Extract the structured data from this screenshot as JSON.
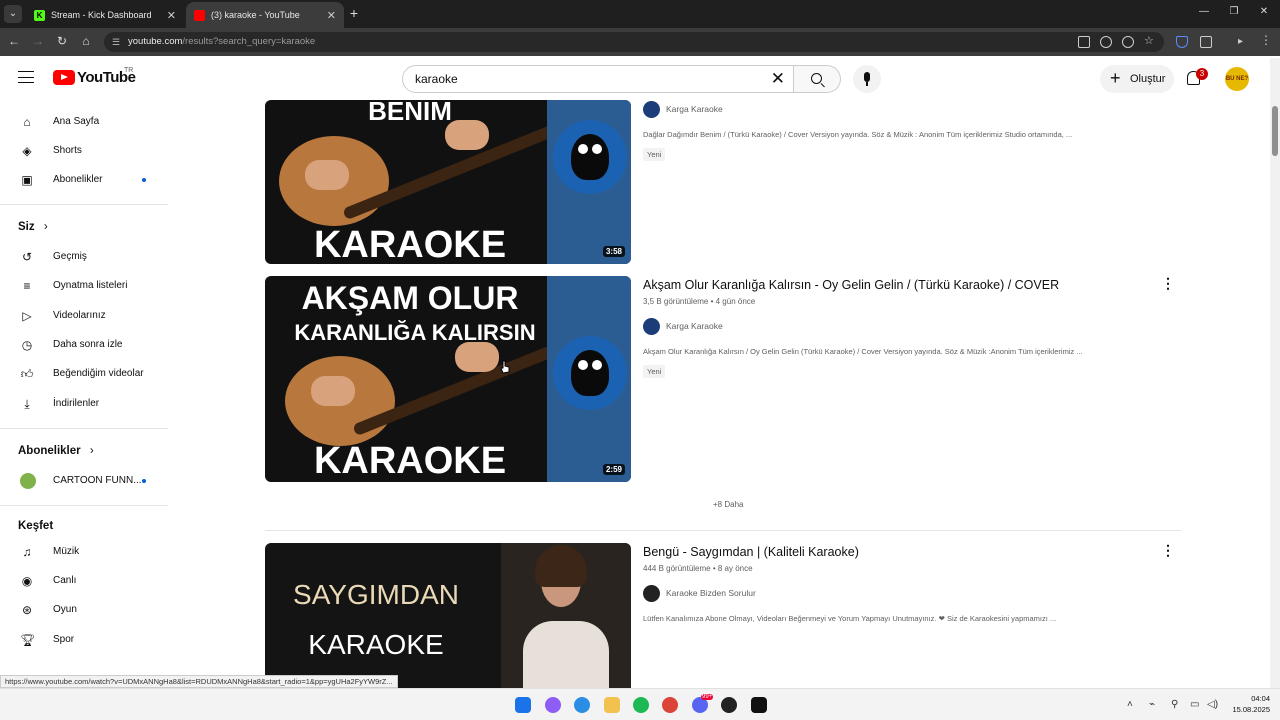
{
  "browser": {
    "tabs": [
      {
        "title": "Stream - Kick Dashboard",
        "favicon": "kick-icon"
      },
      {
        "title": "(3) karaoke - YouTube",
        "favicon": "youtube-icon"
      }
    ],
    "url_host": "youtube.com",
    "url_path": "/results?search_query=karaoke"
  },
  "masthead": {
    "logo": "YouTube",
    "region": "TR",
    "search_value": "karaoke",
    "create_label": "Oluştur",
    "notification_count": "3",
    "avatar_text": "BU NE?"
  },
  "sidebar": {
    "main": [
      {
        "label": "Ana Sayfa",
        "icon": "home-icon"
      },
      {
        "label": "Shorts",
        "icon": "shorts-icon"
      },
      {
        "label": "Abonelikler",
        "icon": "subscriptions-icon"
      }
    ],
    "you_heading": "Siz",
    "you": [
      {
        "label": "Geçmiş",
        "icon": "history-icon"
      },
      {
        "label": "Oynatma listeleri",
        "icon": "playlists-icon"
      },
      {
        "label": "Videolarınız",
        "icon": "your-videos-icon"
      },
      {
        "label": "Daha sonra izle",
        "icon": "watch-later-icon"
      },
      {
        "label": "Beğendiğim videolar",
        "icon": "liked-icon"
      },
      {
        "label": "İndirilenler",
        "icon": "downloads-icon"
      }
    ],
    "subs_heading": "Abonelikler",
    "subs": [
      {
        "label": "CARTOON FUNN..."
      }
    ],
    "explore_heading": "Keşfet",
    "explore": [
      {
        "label": "Müzik",
        "icon": "music-icon"
      },
      {
        "label": "Canlı",
        "icon": "live-icon"
      },
      {
        "label": "Oyun",
        "icon": "gaming-icon"
      },
      {
        "label": "Spor",
        "icon": "sports-icon"
      }
    ]
  },
  "results": [
    {
      "thumb_top": "BENIM",
      "thumb_bottom": "KARAOKE",
      "duration": "3:58",
      "channel": "Karga Karaoke",
      "description": "Dağlar Dağımdır Benim / (Türkü Karaoke) / Cover Versiyon yayında. Söz & Müzik : Anonim Tüm içeriklerimiz Studio ortamında, ...",
      "badge": "Yeni"
    },
    {
      "thumb_top": "AKŞAM OLUR",
      "thumb_mid": "KARANLIĞA KALIRSIN",
      "thumb_bottom": "KARAOKE",
      "duration": "2:59",
      "title": "Akşam Olur Karanlığa Kalırsın - Oy Gelin Gelin / (Türkü Karaoke) / COVER",
      "views": "3,5 B görüntüleme",
      "age": "4 gün önce",
      "channel": "Karga Karaoke",
      "description": "Akşam Olur Karanlığa Kalırsın / Oy Gelin Gelin (Türkü Karaoke) / Cover Versiyon yayında. Söz & Müzik :Anonim Tüm içeriklerimiz ...",
      "badge": "Yeni"
    },
    {
      "thumb_top": "SAYGIMDAN",
      "thumb_bottom": "KARAOKE",
      "title": "Bengü - Saygımdan | (Kaliteli Karaoke)",
      "views": "444 B görüntüleme",
      "age": "8 ay önce",
      "channel": "Karaoke Bizden Sorulur",
      "description": "Lütfen Kanalımıza Abone Olmayı, Videoları Beğenmeyi ve Yorum Yapmayı Unutmayınız. ❤ Siz de Karaokesini yapmamızı ..."
    }
  ],
  "more_label": "+8 Daha",
  "status_url": "https://www.youtube.com/watch?v=UDMxANNgHa8&list=RDUDMxANNgHa8&start_radio=1&pp=ygUHa2FyYW9rZ...",
  "taskbar": {
    "time": "04:04",
    "date": "15.08.2025",
    "notif_badge": "99+"
  }
}
